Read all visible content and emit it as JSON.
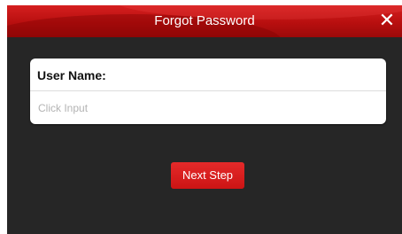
{
  "dialog": {
    "title": "Forgot Password",
    "close_icon": "close-icon"
  },
  "form": {
    "username_label": "User Name:",
    "username_placeholder": "Click Input",
    "username_value": ""
  },
  "actions": {
    "next_label": "Next Step"
  },
  "colors": {
    "accent": "#c81414",
    "background": "#262626",
    "card": "#ffffff"
  }
}
